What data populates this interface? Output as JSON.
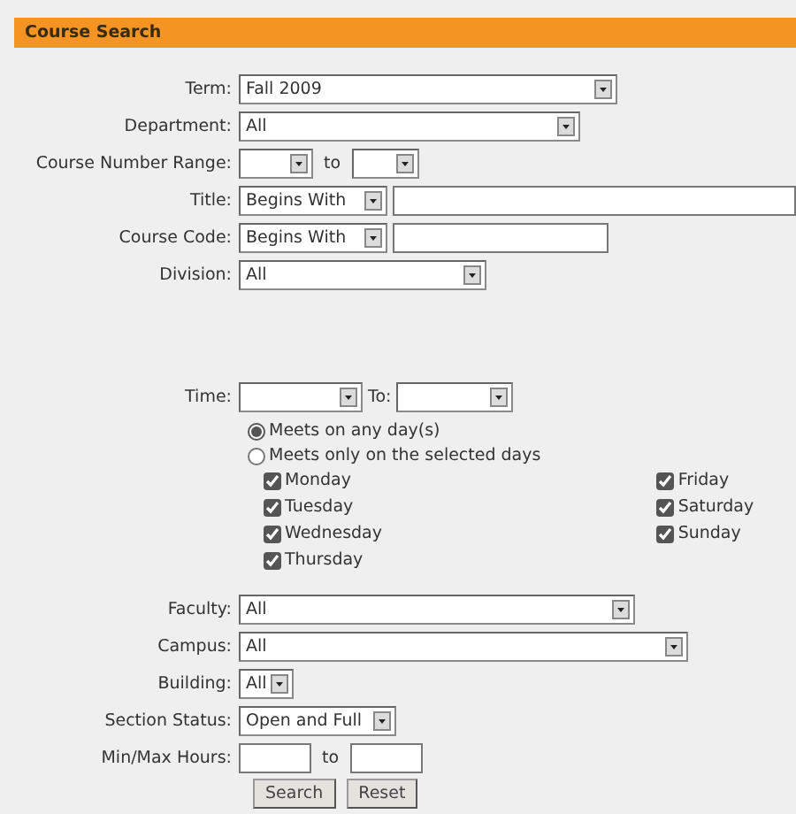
{
  "header": {
    "title": "Course Search"
  },
  "upper_fields": [
    {
      "label": "Term:",
      "controls": [
        {
          "kind": "select",
          "value": "Fall 2009"
        }
      ]
    },
    {
      "label": "Department:",
      "controls": [
        {
          "kind": "select",
          "value": "All"
        }
      ]
    },
    {
      "label": "Course Number Range:",
      "controls": [
        {
          "kind": "select"
        },
        {
          "kind": "word",
          "value": "to"
        },
        {
          "kind": "select"
        }
      ]
    },
    {
      "label": "Title:",
      "controls": [
        {
          "kind": "select",
          "value": "Begins With"
        },
        {
          "kind": "input"
        }
      ]
    },
    {
      "label": "Course Code:",
      "controls": [
        {
          "kind": "select",
          "value": "Begins With"
        },
        {
          "kind": "input"
        }
      ]
    },
    {
      "label": "Division:",
      "controls": [
        {
          "kind": "select",
          "value": "All"
        }
      ]
    }
  ],
  "time": {
    "label": "Time:",
    "to_label": "To:"
  },
  "meeting_options": [
    {
      "label": "Meets on any day(s)",
      "selected": true
    },
    {
      "label": "Meets only on the selected days",
      "selected": false
    }
  ],
  "day_columns": [
    [
      {
        "label": "Monday",
        "checked": true
      },
      {
        "label": "Tuesday",
        "checked": true
      },
      {
        "label": "Wednesday",
        "checked": true
      },
      {
        "label": "Thursday",
        "checked": true
      }
    ],
    [
      {
        "label": "Friday",
        "checked": true
      },
      {
        "label": "Saturday",
        "checked": true
      },
      {
        "label": "Sunday",
        "checked": true
      }
    ]
  ],
  "lower_fields": [
    {
      "label": "Faculty:",
      "controls": [
        {
          "kind": "select",
          "value": "All"
        }
      ]
    },
    {
      "label": "Campus:",
      "controls": [
        {
          "kind": "select",
          "value": "All"
        }
      ]
    },
    {
      "label": "Building:",
      "controls": [
        {
          "kind": "select",
          "value": "All"
        }
      ]
    },
    {
      "label": "Section Status:",
      "controls": [
        {
          "kind": "select",
          "value": "Open and Full"
        }
      ]
    },
    {
      "label": "Min/Max Hours:",
      "controls": [
        {
          "kind": "input"
        },
        {
          "kind": "word",
          "value": "to"
        },
        {
          "kind": "input"
        }
      ]
    }
  ],
  "buttons": [
    "Search",
    "Reset"
  ]
}
